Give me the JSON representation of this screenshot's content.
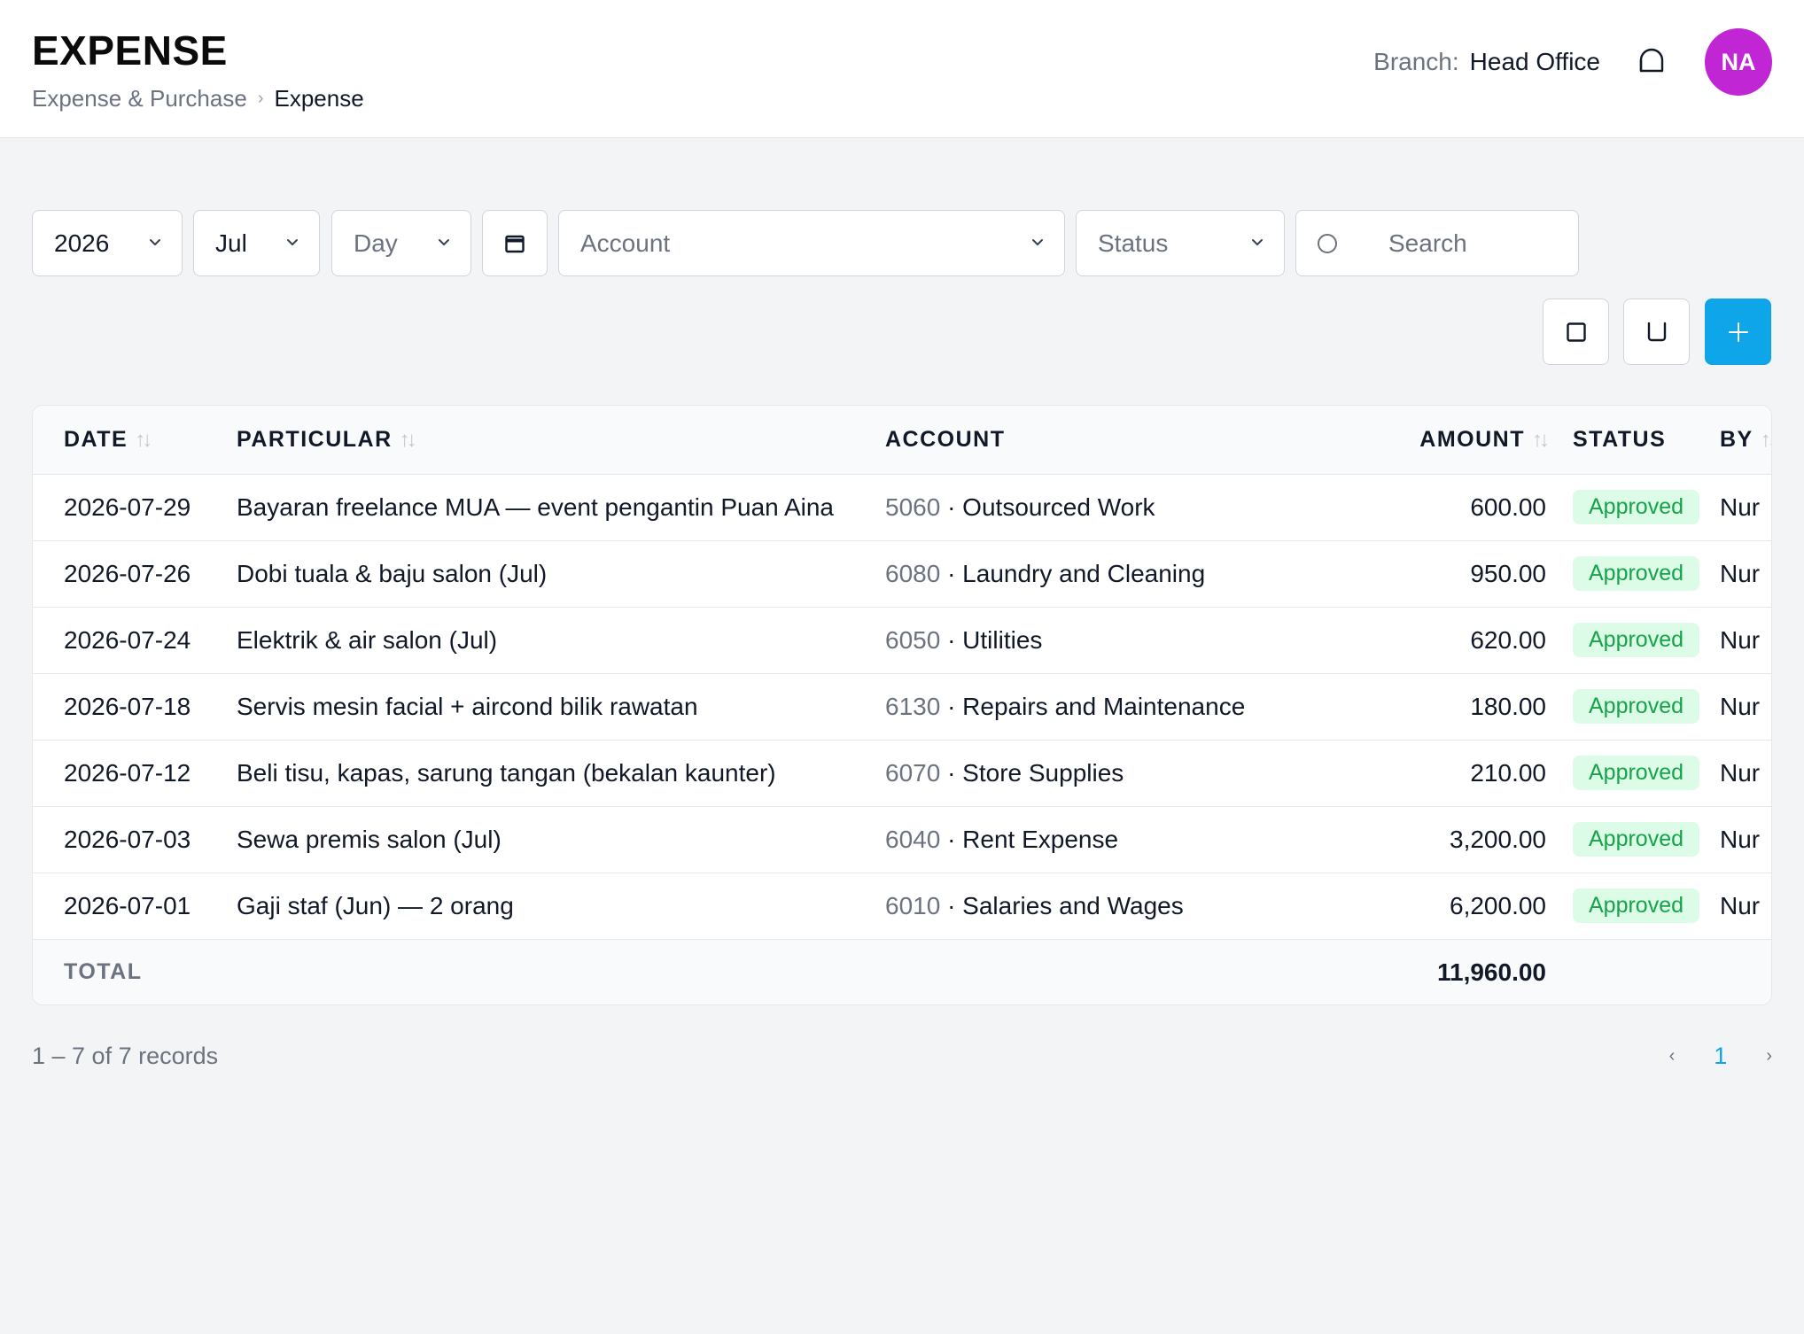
{
  "header": {
    "title": "EXPENSE",
    "breadcrumb": {
      "parent": "Expense & Purchase",
      "separator": "›",
      "current": "Expense"
    },
    "branch_label": "Branch:",
    "branch_value": "Head Office",
    "bell_icon": "bell-icon",
    "avatar_initials": "NA",
    "avatar_color": "#c026d3"
  },
  "filters": {
    "year": "2026",
    "month": "Jul",
    "day_placeholder": "Day",
    "account_placeholder": "Account",
    "status_placeholder": "Status",
    "search_placeholder": "Search"
  },
  "actions": {
    "accent_color": "#0ea5e9"
  },
  "table": {
    "headers": {
      "date": "DATE",
      "particular": "PARTICULAR",
      "account": "ACCOUNT",
      "amount": "AMOUNT",
      "status": "STATUS",
      "by": "BY"
    },
    "rows": [
      {
        "date": "2026-07-29",
        "particular": "Bayaran freelance MUA — event pengantin Puan Aina",
        "account_code": "5060",
        "account_name": "· Outsourced Work",
        "amount": "600.00",
        "status": "Approved",
        "by": "Nur"
      },
      {
        "date": "2026-07-26",
        "particular": "Dobi tuala & baju salon (Jul)",
        "account_code": "6080",
        "account_name": "· Laundry and Cleaning",
        "amount": "950.00",
        "status": "Approved",
        "by": "Nur"
      },
      {
        "date": "2026-07-24",
        "particular": "Elektrik & air salon (Jul)",
        "account_code": "6050",
        "account_name": "· Utilities",
        "amount": "620.00",
        "status": "Approved",
        "by": "Nur"
      },
      {
        "date": "2026-07-18",
        "particular": "Servis mesin facial + aircond bilik rawatan",
        "account_code": "6130",
        "account_name": "· Repairs and Maintenance",
        "amount": "180.00",
        "status": "Approved",
        "by": "Nur"
      },
      {
        "date": "2026-07-12",
        "particular": "Beli tisu, kapas, sarung tangan (bekalan kaunter)",
        "account_code": "6070",
        "account_name": "· Store Supplies",
        "amount": "210.00",
        "status": "Approved",
        "by": "Nur"
      },
      {
        "date": "2026-07-03",
        "particular": "Sewa premis salon (Jul)",
        "account_code": "6040",
        "account_name": "· Rent Expense",
        "amount": "3,200.00",
        "status": "Approved",
        "by": "Nur"
      },
      {
        "date": "2026-07-01",
        "particular": "Gaji staf (Jun) — 2 orang",
        "account_code": "6010",
        "account_name": "· Salaries and Wages",
        "amount": "6,200.00",
        "status": "Approved",
        "by": "Nur"
      }
    ],
    "total_label": "TOTAL",
    "total_value": "11,960.00",
    "status_color": "#16a34a"
  },
  "pagination": {
    "summary": "1 – 7 of 7 records",
    "prev": "‹",
    "current_page": "1",
    "next": "›"
  }
}
